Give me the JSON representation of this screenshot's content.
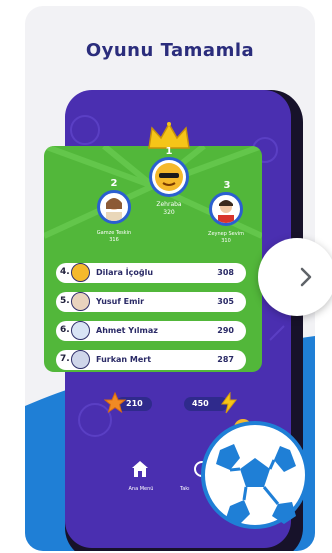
{
  "page": {
    "title": "Oyunu Tamamla"
  },
  "podium": {
    "first": {
      "rank": "1",
      "name": "Zehraba",
      "score": "320"
    },
    "second": {
      "rank": "2",
      "name": "Gamze Teskin",
      "score": "316"
    },
    "third": {
      "rank": "3",
      "name": "Zeynep Sevim",
      "score": "310"
    }
  },
  "leaderboard": [
    {
      "rank": "4.",
      "name": "Dilara İçoğlu",
      "score": "308"
    },
    {
      "rank": "5.",
      "name": "Yusuf Emir",
      "score": "305"
    },
    {
      "rank": "6.",
      "name": "Ahmet Yılmaz",
      "score": "290"
    },
    {
      "rank": "7.",
      "name": "Furkan Mert",
      "score": "287"
    }
  ],
  "stats": {
    "stars": "210",
    "energy": "450"
  },
  "nav": {
    "home_label": "Ana Menü",
    "second_label": "Takı"
  },
  "colors": {
    "title": "#2b2d7c",
    "panel_green": "#52b73a",
    "screen_purple": "#4a2fb0",
    "accent_blue": "#1f7fd6"
  },
  "icons": [
    "crown-icon",
    "home-icon",
    "star-icon",
    "bolt-icon",
    "chevron-right-icon",
    "soccer-ball-icon"
  ]
}
